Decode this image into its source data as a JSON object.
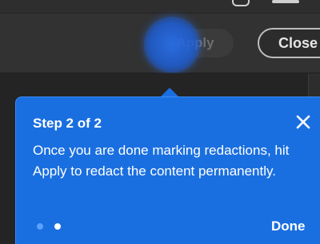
{
  "toolbar": {
    "apply_label": "Apply",
    "close_label": "Close"
  },
  "coachmark": {
    "step_label": "Step 2 of 2",
    "body": "Once you are done marking redactions, hit Apply to redact the content permanently.",
    "done_label": "Done",
    "pager": {
      "current": 2,
      "total": 2
    },
    "background_color": "#1a6fe0"
  },
  "icons": {
    "close": "close-icon"
  }
}
